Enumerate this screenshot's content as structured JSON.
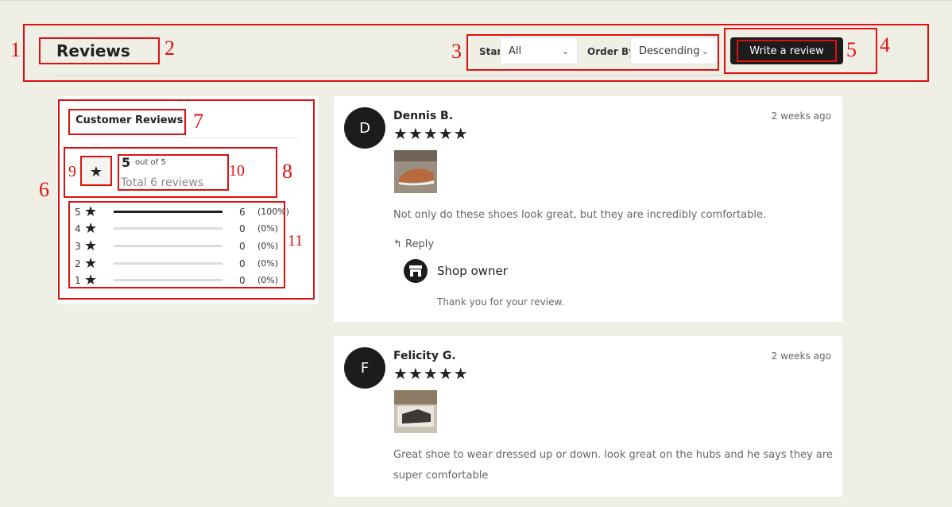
{
  "header": {
    "title": "Reviews",
    "star_filter_label": "Star",
    "star_filter_value": "All",
    "order_label": "Order By",
    "order_value": "Descending",
    "write_review_label": "Write a review"
  },
  "summary": {
    "title": "Customer Reviews",
    "average": "5",
    "out_of": "out of 5",
    "total": "Total 6 reviews",
    "distribution": [
      {
        "level": "5",
        "count": "6",
        "percent": "(100%)",
        "fraction": 1.0
      },
      {
        "level": "4",
        "count": "0",
        "percent": "(0%)",
        "fraction": 0
      },
      {
        "level": "3",
        "count": "0",
        "percent": "(0%)",
        "fraction": 0
      },
      {
        "level": "2",
        "count": "0",
        "percent": "(0%)",
        "fraction": 0
      },
      {
        "level": "1",
        "count": "0",
        "percent": "(0%)",
        "fraction": 0
      }
    ]
  },
  "reviews": [
    {
      "initial": "D",
      "name": "Dennis B.",
      "stars": "★★★★★",
      "date": "2 weeks ago",
      "text": "Not only do these shoes look great, but they are incredibly comfortable.",
      "reply_label": "Reply",
      "owner_name": "Shop owner",
      "owner_reply": "Thank you for your review."
    },
    {
      "initial": "F",
      "name": "Felicity G.",
      "stars": "★★★★★",
      "date": "2 weeks ago",
      "text": "Great shoe to wear dressed up or down. look great on the hubs and he says they are super comfortable"
    }
  ],
  "annotations": [
    "1",
    "2",
    "3",
    "4",
    "5",
    "6",
    "7",
    "8",
    "9",
    "10",
    "11"
  ],
  "colors": {
    "annotation": "#dd1111",
    "button": "#1c1c1c",
    "background": "#f0efe6"
  }
}
